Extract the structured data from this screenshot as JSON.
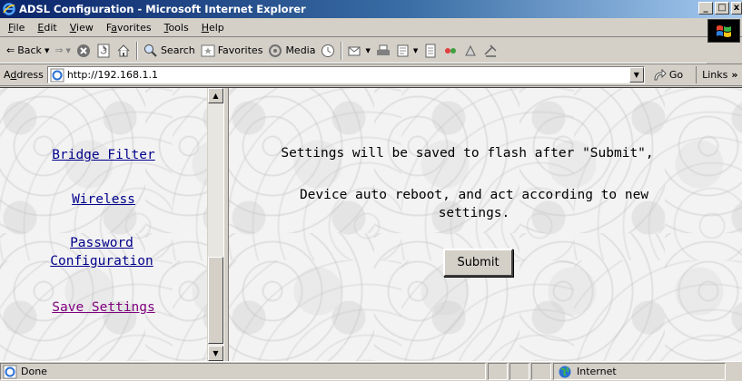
{
  "window": {
    "title": "ADSL Configuration - Microsoft Internet Explorer",
    "controls": [
      "_",
      "□",
      "x"
    ]
  },
  "menu": [
    {
      "accel": "F",
      "rest": "ile"
    },
    {
      "accel": "E",
      "rest": "dit"
    },
    {
      "accel": "V",
      "rest": "iew"
    },
    {
      "pre": "F",
      "accel": "a",
      "rest": "vorites"
    },
    {
      "accel": "T",
      "rest": "ools"
    },
    {
      "accel": "H",
      "rest": "elp"
    }
  ],
  "toolbar": {
    "back_label": "Back",
    "search_label": "Search",
    "favorites_label": "Favorites",
    "media_label": "Media"
  },
  "address": {
    "label_pre": "A",
    "label_accel": "d",
    "label_rest": "dress",
    "url": "http://192.168.1.1",
    "go_label": "Go",
    "links_label": "Links",
    "links_more": "»"
  },
  "left_nav": [
    {
      "label": "Bridge Filter"
    },
    {
      "label": "Wireless"
    },
    {
      "label": "Password Configuration"
    },
    {
      "label": "Save Settings"
    }
  ],
  "main": {
    "message_1": "Settings will be saved to flash after \"Submit\",",
    "message_2": "Device auto reboot, and act according to new settings.",
    "submit_label": "Submit"
  },
  "status": {
    "text": "Done",
    "zone": "Internet"
  },
  "colors": {
    "titlebar_start": "#0a246a",
    "titlebar_end": "#a6caf0",
    "link": "#00008b",
    "visited_link": "#800080",
    "chrome": "#d4d0c8"
  }
}
